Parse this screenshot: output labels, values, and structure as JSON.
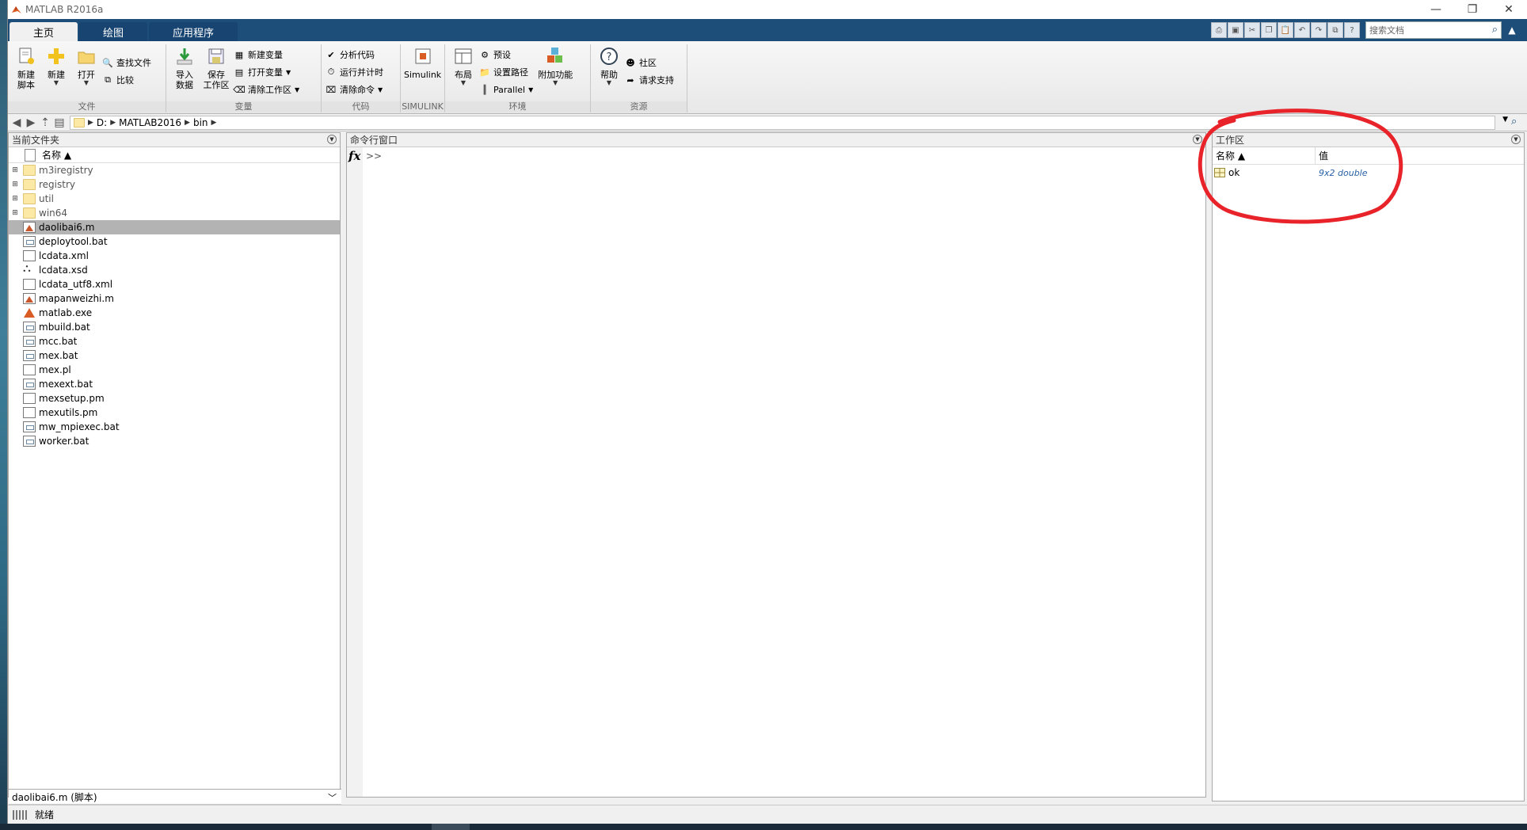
{
  "window": {
    "title": "MATLAB R2016a",
    "controls": [
      "—",
      "❐",
      "✕"
    ]
  },
  "tabs": [
    {
      "label": "主页",
      "active": true
    },
    {
      "label": "绘图",
      "active": false
    },
    {
      "label": "应用程序",
      "active": false
    }
  ],
  "search": {
    "placeholder": "搜索文档"
  },
  "ribbon": {
    "file": {
      "label": "文件",
      "new_script": "新建\n脚本",
      "new": "新建",
      "open": "打开",
      "find_files": "查找文件",
      "compare": "比较"
    },
    "variable": {
      "label": "变量",
      "import": "导入\n数据",
      "save_ws": "保存\n工作区",
      "new_var": "新建变量",
      "open_var": "打开变量",
      "clear_ws": "清除工作区"
    },
    "code": {
      "label": "代码",
      "analyze": "分析代码",
      "run_time": "运行并计时",
      "clear_cmd": "清除命令"
    },
    "simulink": {
      "label": "SIMULINK",
      "btn": "Simulink"
    },
    "env": {
      "label": "环境",
      "layout": "布局",
      "prefs": "预设",
      "set_path": "设置路径",
      "parallel": "Parallel",
      "addons": "附加功能"
    },
    "resources": {
      "label": "资源",
      "help": "帮助",
      "community": "社区",
      "support": "请求支持"
    }
  },
  "address": {
    "segments": [
      "D:",
      "MATLAB2016",
      "bin"
    ]
  },
  "current_folder": {
    "title": "当前文件夹",
    "column": "名称 ▲",
    "items": [
      {
        "name": "m3iregistry",
        "type": "folder"
      },
      {
        "name": "registry",
        "type": "folder"
      },
      {
        "name": "util",
        "type": "folder"
      },
      {
        "name": "win64",
        "type": "folder"
      },
      {
        "name": "daolibai6.m",
        "type": "m",
        "selected": true
      },
      {
        "name": "deploytool.bat",
        "type": "bat"
      },
      {
        "name": "lcdata.xml",
        "type": "doc"
      },
      {
        "name": "lcdata.xsd",
        "type": "xsd"
      },
      {
        "name": "lcdata_utf8.xml",
        "type": "doc"
      },
      {
        "name": "mapanweizhi.m",
        "type": "m"
      },
      {
        "name": "matlab.exe",
        "type": "exe"
      },
      {
        "name": "mbuild.bat",
        "type": "bat"
      },
      {
        "name": "mcc.bat",
        "type": "bat"
      },
      {
        "name": "mex.bat",
        "type": "bat"
      },
      {
        "name": "mex.pl",
        "type": "doc"
      },
      {
        "name": "mexext.bat",
        "type": "bat"
      },
      {
        "name": "mexsetup.pm",
        "type": "doc"
      },
      {
        "name": "mexutils.pm",
        "type": "doc"
      },
      {
        "name": "mw_mpiexec.bat",
        "type": "bat"
      },
      {
        "name": "worker.bat",
        "type": "bat"
      }
    ],
    "details": "daolibai6.m  (脚本)"
  },
  "command_window": {
    "title": "命令行窗口",
    "fx": "fx",
    "prompt": ">>"
  },
  "workspace": {
    "title": "工作区",
    "col_name": "名称 ▲",
    "col_value": "值",
    "vars": [
      {
        "name": "ok",
        "value": "9x2 double"
      }
    ]
  },
  "status": {
    "text": "就绪"
  },
  "colors": {
    "accent": "#1d4e7a",
    "annotation": "#e8232a",
    "selection": "#b3b3b3"
  }
}
